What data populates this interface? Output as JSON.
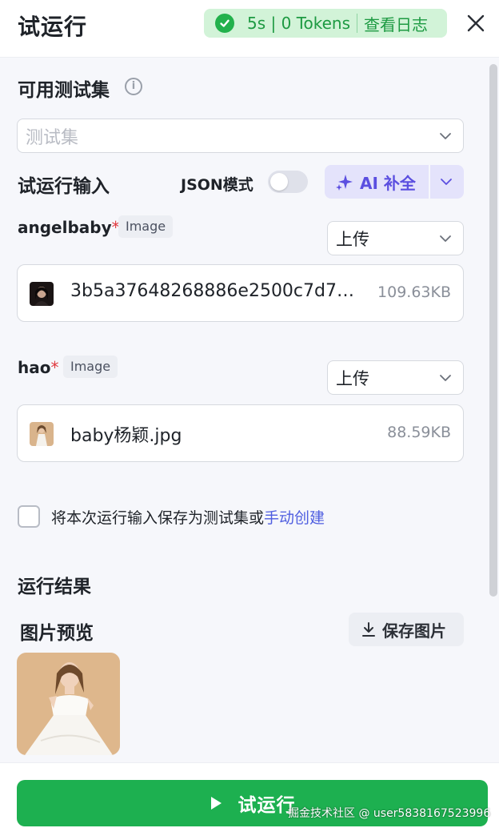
{
  "header": {
    "title": "试运行",
    "status": {
      "time": "5s",
      "tokens": "0 Tokens",
      "log_link": "查看日志"
    }
  },
  "testset": {
    "title": "可用测试集",
    "placeholder": "测试集"
  },
  "input": {
    "title": "试运行输入",
    "json_mode_label": "JSON模式",
    "json_mode_on": false,
    "ai_button": "AI 补全"
  },
  "fields": [
    {
      "name": "angelbaby",
      "required_mark": "*",
      "type_tag": "Image",
      "mode": "上传",
      "file_name": "3b5a37648268886e2500c7d7…",
      "file_size": "109.63KB"
    },
    {
      "name": "hao",
      "required_mark": "*",
      "type_tag": "Image",
      "mode": "上传",
      "file_name": "baby杨颖.jpg",
      "file_size": "88.59KB"
    }
  ],
  "save_option": {
    "checked": false,
    "text": "将本次运行输入保存为测试集或",
    "link": "手动创建"
  },
  "result": {
    "title": "运行结果",
    "preview_title": "图片预览",
    "save_image_label": "保存图片"
  },
  "footer": {
    "run_label": "试运行",
    "watermark": "掘金技术社区 @ user5838167523996"
  },
  "colors": {
    "primary_green": "#1db050",
    "status_bg": "#d2f3d8",
    "ai_purple": "#5b4fe0",
    "link_blue": "#4f5ee0",
    "required_red": "#e0393e"
  }
}
